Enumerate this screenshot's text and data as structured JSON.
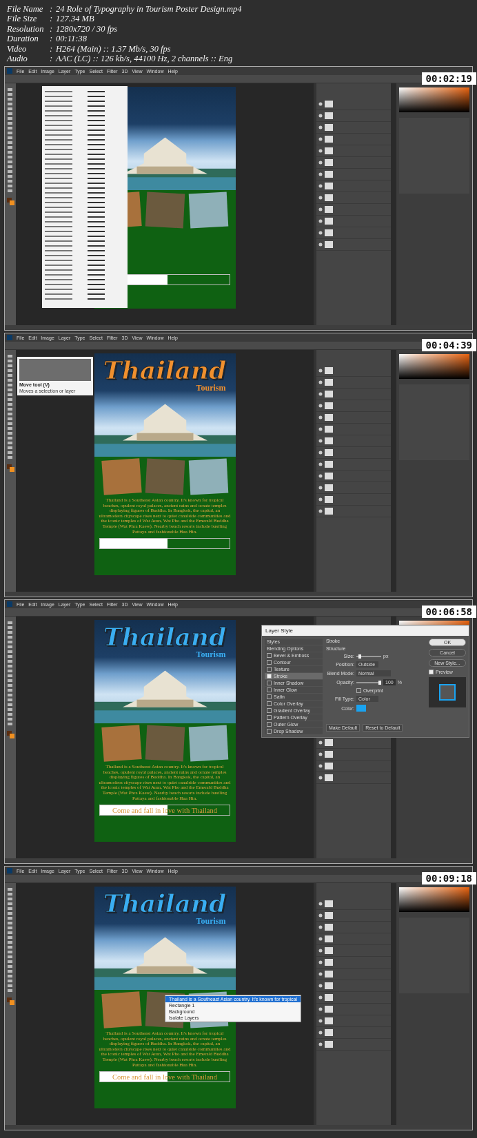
{
  "file_info": [
    {
      "label": "File Name",
      "sep": ":",
      "value": "24 Role of Typography in Tourism Poster Design.mp4"
    },
    {
      "label": "File Size",
      "sep": ":",
      "value": "127.34 MB"
    },
    {
      "label": "Resolution",
      "sep": ":",
      "value": "1280x720 / 30 fps"
    },
    {
      "label": "Duration",
      "sep": ":",
      "value": "00:11:38"
    },
    {
      "label": "Video",
      "sep": ":",
      "value": "H264 (Main) :: 1.37 Mb/s, 30 fps"
    },
    {
      "label": "Audio",
      "sep": ":",
      "value": "AAC (LC) :: 126 kb/s, 44100 Hz, 2 channels :: Eng"
    }
  ],
  "frames": [
    {
      "timestamp": "00:02:19",
      "menu": [
        "File",
        "Edit",
        "Image",
        "Layer",
        "Type",
        "Select",
        "Filter",
        "3D",
        "View",
        "Window",
        "Help"
      ],
      "poster": {
        "banner_outline": true
      },
      "overlay": {
        "kind": "font-menu"
      }
    },
    {
      "timestamp": "00:04:39",
      "menu": [
        "File",
        "Edit",
        "Image",
        "Layer",
        "Type",
        "Select",
        "Filter",
        "3D",
        "View",
        "Window",
        "Help"
      ],
      "poster": {
        "title": {
          "text": "Thailand",
          "color": "#f0902e"
        },
        "subtitle": "Tourism",
        "paragraph": "Thailand is a Southeast Asian country. It's known for tropical beaches, opulent royal palaces, ancient ruins and ornate temples displaying figures of Buddha. In Bangkok, the capital, an ultramodern cityscape rises next to quiet canalside communities and the iconic temples of Wat Arun, Wat Pho and the Emerald Buddha Temple (Wat Phra Kaew). Nearby beach resorts include bustling Pattaya and fashionable Hua Hin.",
        "banner_outline": true
      },
      "overlay": {
        "kind": "tooltip",
        "title": "Move tool (V)",
        "text": "Moves a selection or layer"
      }
    },
    {
      "timestamp": "00:06:58",
      "menu": [
        "File",
        "Edit",
        "Image",
        "Layer",
        "Type",
        "Select",
        "Filter",
        "3D",
        "View",
        "Window",
        "Help"
      ],
      "poster": {
        "title": {
          "text": "Thailand",
          "color": "#3aaef2"
        },
        "subtitle": "Tourism",
        "paragraph": "Thailand is a Southeast Asian country. It's known for tropical beaches, opulent royal palaces, ancient ruins and ornate temples displaying figures of Buddha. In Bangkok, the capital, an ultramodern cityscape rises next to quiet canalside communities and the iconic temples of Wat Arun, Wat Pho and the Emerald Buddha Temple (Wat Phra Kaew). Nearby beach resorts include bustling Pattaya and fashionable Hua Hin.",
        "banner": "Come and fall in love with Thailand",
        "banner_outline": true
      },
      "overlay": {
        "kind": "layer-style",
        "title": "Layer Style",
        "styles": [
          {
            "label": "Styles",
            "kind": "header",
            "selected": false
          },
          {
            "label": "Blending Options",
            "kind": "header",
            "selected": false
          },
          {
            "label": "Bevel & Emboss",
            "kind": "checkbox",
            "checked": false,
            "selected": false
          },
          {
            "label": "Contour",
            "kind": "checkbox",
            "checked": false,
            "selected": false
          },
          {
            "label": "Texture",
            "kind": "checkbox",
            "checked": false,
            "selected": false
          },
          {
            "label": "Stroke",
            "kind": "checkbox",
            "checked": true,
            "selected": true
          },
          {
            "label": "Inner Shadow",
            "kind": "checkbox",
            "checked": false,
            "selected": false
          },
          {
            "label": "Inner Glow",
            "kind": "checkbox",
            "checked": false,
            "selected": false
          },
          {
            "label": "Satin",
            "kind": "checkbox",
            "checked": false,
            "selected": false
          },
          {
            "label": "Color Overlay",
            "kind": "checkbox",
            "checked": false,
            "selected": false
          },
          {
            "label": "Gradient Overlay",
            "kind": "checkbox",
            "checked": false,
            "selected": false
          },
          {
            "label": "Pattern Overlay",
            "kind": "checkbox",
            "checked": false,
            "selected": false
          },
          {
            "label": "Outer Glow",
            "kind": "checkbox",
            "checked": false,
            "selected": false
          },
          {
            "label": "Drop Shadow",
            "kind": "checkbox",
            "checked": false,
            "selected": false
          }
        ],
        "section": "Stroke",
        "group": "Structure",
        "size_label": "Size:",
        "size_slider": {
          "level": 0.1
        },
        "unit": "px",
        "position_label": "Position:",
        "position": "Outside",
        "blend_label": "Blend Mode:",
        "blend": "Normal",
        "opacity_label": "Opacity:",
        "opacity_slider": {
          "level": 1
        },
        "opacity": "100",
        "percent": "%",
        "overprint": "Overprint",
        "overprint_checked": false,
        "fill_label": "Fill Type:",
        "fill": "Color",
        "color_label": "Color:",
        "color": "#1aa3f0",
        "buttons": [
          "Make Default",
          "Reset to Default"
        ],
        "side_buttons": [
          "OK",
          "Cancel",
          "New Style..."
        ],
        "preview": "Preview",
        "preview_checked": true
      }
    },
    {
      "timestamp": "00:09:18",
      "menu": [
        "File",
        "Edit",
        "Image",
        "Layer",
        "Type",
        "Select",
        "Filter",
        "3D",
        "View",
        "Window",
        "Help"
      ],
      "poster": {
        "title": {
          "text": "Thailand",
          "color": "#3aaef2"
        },
        "subtitle": "Tourism",
        "paragraph": "Thailand is a Southeast Asian country. It's known for tropical beaches, opulent royal palaces, ancient ruins and ornate temples displaying figures of Buddha. In Bangkok, the capital, an ultramodern cityscape rises next to quiet canalside communities and the iconic temples of Wat Arun, Wat Pho and the Emerald Buddha Temple (Wat Phra Kaew). Nearby beach resorts include bustling Pattaya and fashionable Hua Hin.",
        "banner": "Come and fall in love with Thailand",
        "banner_outline": true
      },
      "overlay": {
        "kind": "context-menu",
        "items": [
          {
            "label": "Thailand is a Southeast Asian country. It's known for tropical",
            "selected": true
          },
          {
            "label": "Rectangle 1",
            "selected": false
          },
          {
            "label": "Background",
            "selected": false
          },
          {
            "label": "Isolate Layers",
            "selected": false
          }
        ]
      }
    }
  ]
}
